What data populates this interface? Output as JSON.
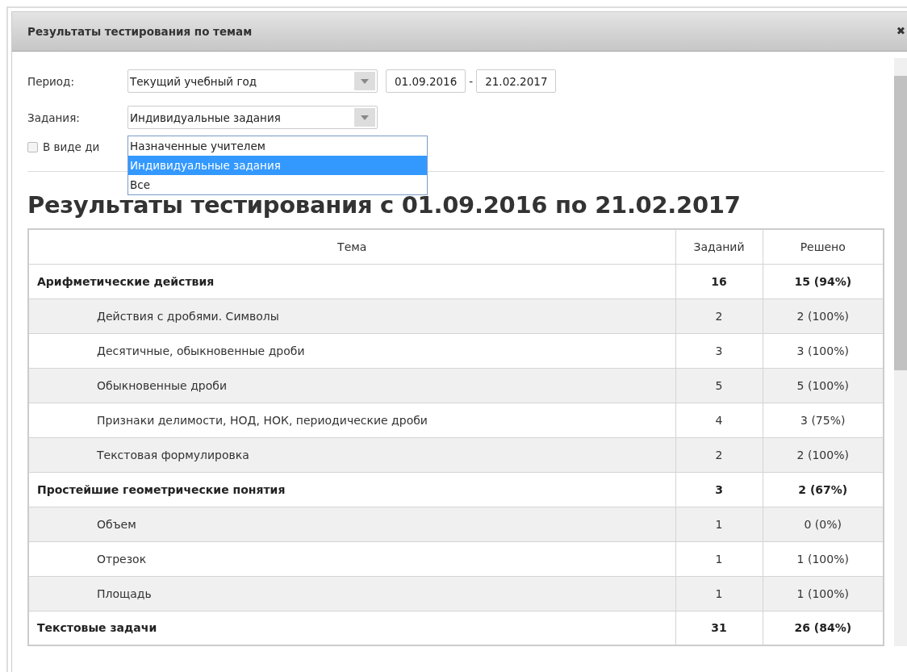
{
  "window": {
    "title": "Результаты тестирования по темам",
    "close": "✖"
  },
  "filters": {
    "period": {
      "label": "Период:",
      "value": "Текущий учебный год",
      "date_from": "01.09.2016",
      "separator": "-",
      "date_to": "21.02.2017"
    },
    "tasks": {
      "label": "Задания:",
      "value": "Индивидуальные задания",
      "expanded": true,
      "options": [
        {
          "label": "Назначенные учителем",
          "selected": false
        },
        {
          "label": "Индивидуальные задания",
          "selected": true
        },
        {
          "label": "Все",
          "selected": false
        }
      ]
    },
    "diagram": {
      "label": "В виде ди",
      "checked": false
    }
  },
  "heading": "Результаты тестирования с 01.09.2016 по 21.02.2017",
  "table": {
    "columns": [
      "Тема",
      "Заданий",
      "Решено"
    ],
    "rows": [
      {
        "kind": "group",
        "cells": [
          "Арифметические действия",
          "16",
          "15 (94%)"
        ]
      },
      {
        "kind": "item",
        "cells": [
          "Действия с дробями. Символы",
          "2",
          "2 (100%)"
        ]
      },
      {
        "kind": "item",
        "cells": [
          "Десятичные, обыкновенные дроби",
          "3",
          "3 (100%)"
        ]
      },
      {
        "kind": "item",
        "cells": [
          "Обыкновенные дроби",
          "5",
          "5 (100%)"
        ]
      },
      {
        "kind": "item",
        "cells": [
          "Признаки делимости, НОД, НОК, периодические дроби",
          "4",
          "3 (75%)"
        ]
      },
      {
        "kind": "item",
        "cells": [
          "Текстовая формулировка",
          "2",
          "2 (100%)"
        ]
      },
      {
        "kind": "group",
        "cells": [
          "Простейшие геометрические понятия",
          "3",
          "2 (67%)"
        ]
      },
      {
        "kind": "item",
        "cells": [
          "Объем",
          "1",
          "0 (0%)"
        ]
      },
      {
        "kind": "item",
        "cells": [
          "Отрезок",
          "1",
          "1 (100%)"
        ]
      },
      {
        "kind": "item",
        "cells": [
          "Площадь",
          "1",
          "1 (100%)"
        ]
      },
      {
        "kind": "group",
        "cells": [
          "Текстовые задачи",
          "31",
          "26 (84%)"
        ]
      }
    ]
  }
}
